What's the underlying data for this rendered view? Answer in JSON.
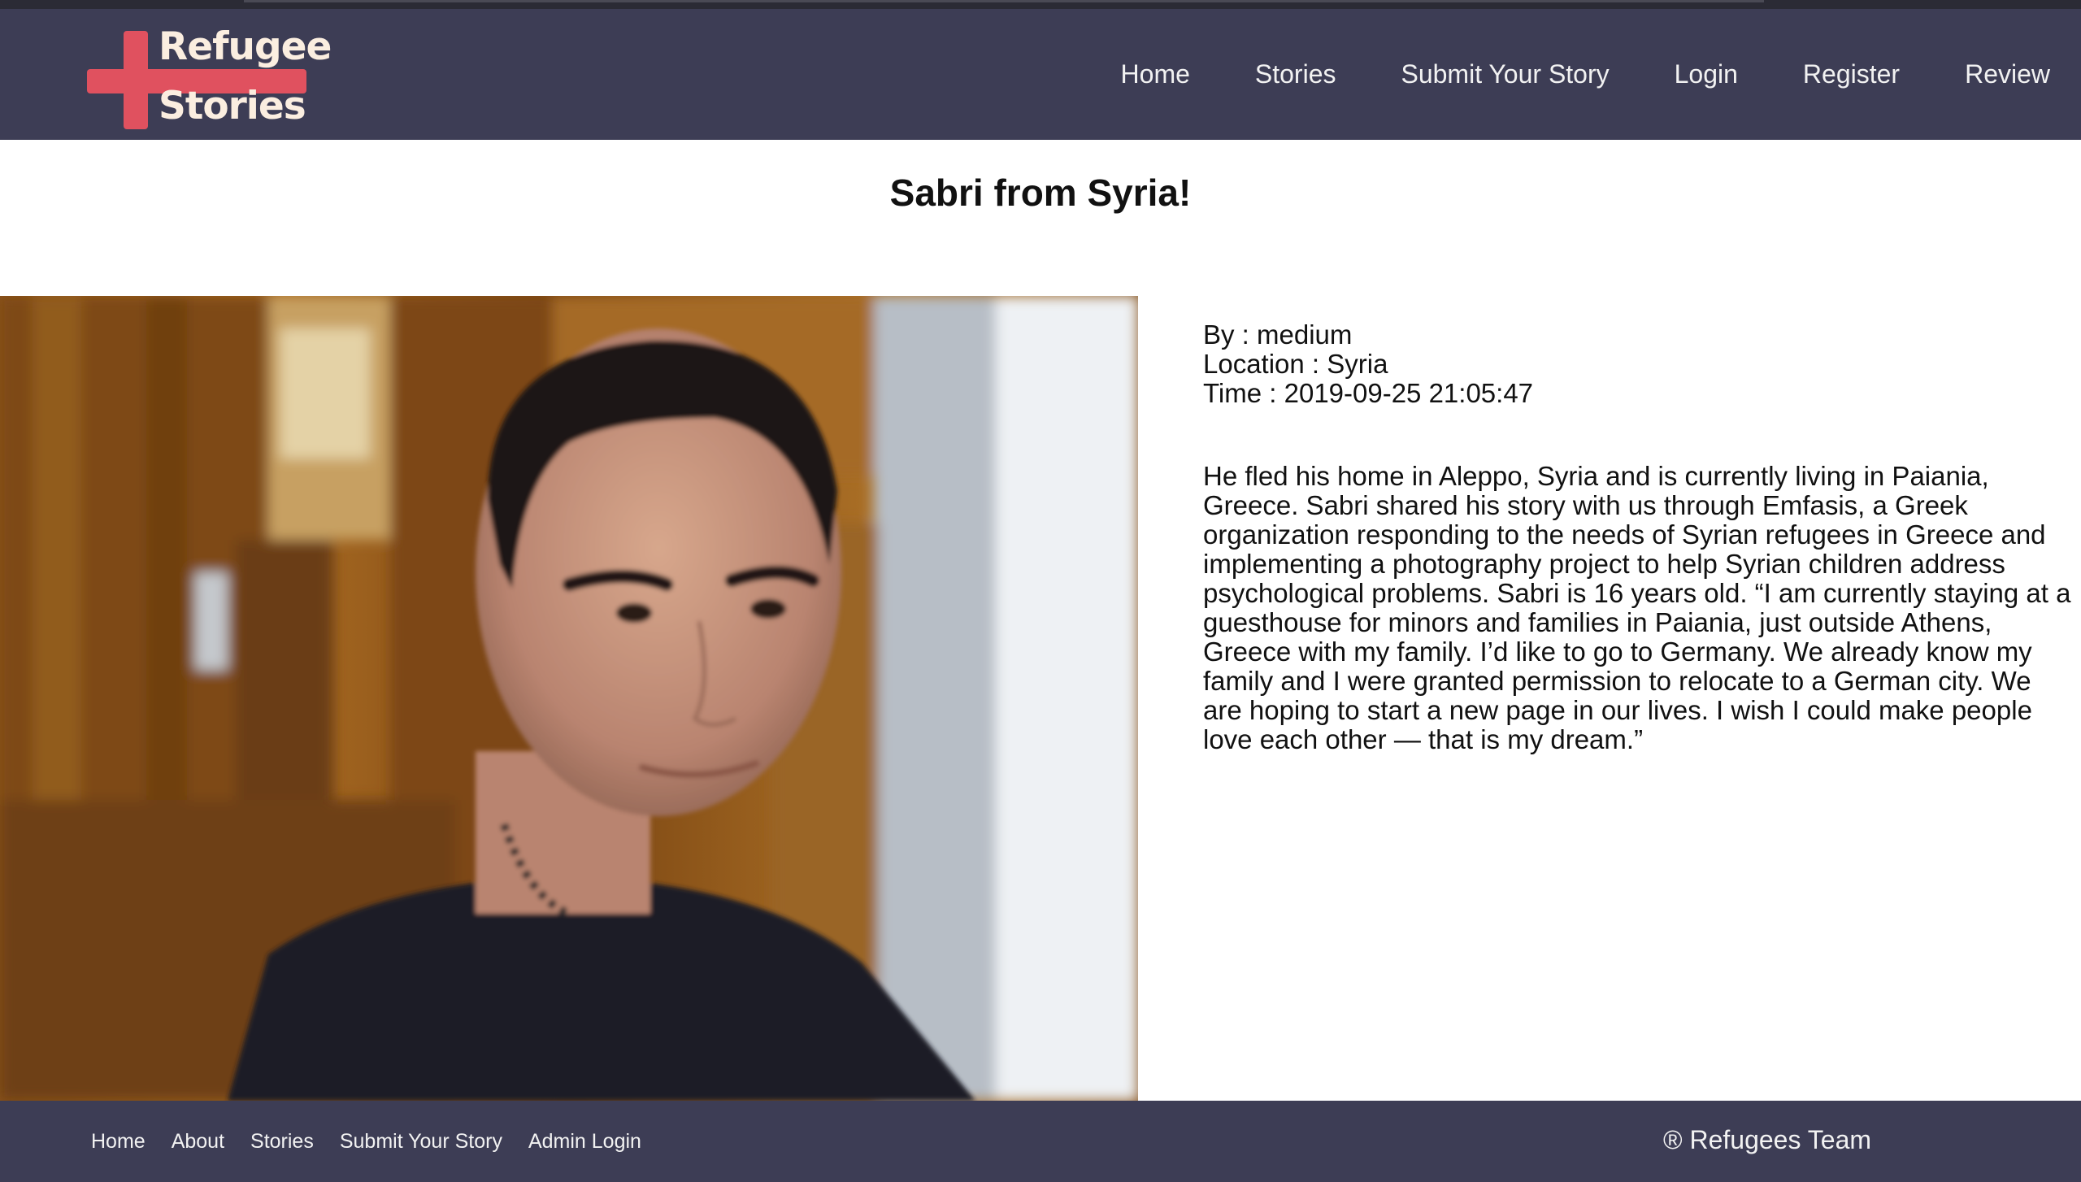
{
  "nav": {
    "logo": {
      "line1": "Refugee",
      "line2": "Stories"
    },
    "links": [
      "Home",
      "Stories",
      "Submit Your Story",
      "Login",
      "Register",
      "Review"
    ]
  },
  "story": {
    "title": "Sabri from Syria!",
    "author": "By : medium",
    "location": "Location : Syria",
    "time": "Time : 2019-09-25 21:05:47",
    "body": "He fled his home in Aleppo, Syria and is currently living in Paiania, Greece. Sabri shared his story with us through Emfasis, a Greek organization responding to the needs of Syrian refugees in Greece and implementing a photography project to help Syrian children address psychological problems. Sabri is 16 years old. “I am currently staying at a guesthouse for minors and families in Paiania, just outside Athens, Greece with my family. I’d like to go to Germany. We already know my family and I were granted permission to relocate to a German city. We are hoping to start a new page in our lives. I wish I could make people love each other — that is my dream.”"
  },
  "footer": {
    "links": [
      "Home",
      "About",
      "Stories",
      "Submit Your Story",
      "Admin Login"
    ],
    "copyright": "® Refugees Team"
  },
  "colors": {
    "nav_bg": "#3d3d55",
    "logo_red": "#e0515f",
    "logo_text": "#fbeee0"
  }
}
